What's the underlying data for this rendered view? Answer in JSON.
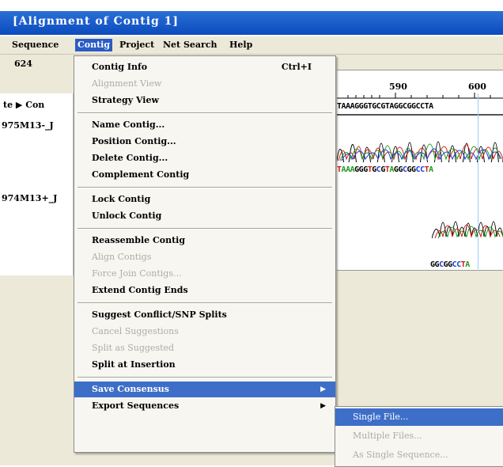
{
  "window": {
    "title": "[Alignment of Contig 1]"
  },
  "menubar": {
    "items": [
      {
        "label": "Sequence"
      },
      {
        "label": "Contig"
      },
      {
        "label": "Project"
      },
      {
        "label": "Net Search"
      },
      {
        "label": "Help"
      }
    ]
  },
  "editor": {
    "position": "624",
    "ticks": [
      "590",
      "600"
    ],
    "header_label": "te ▶ Con",
    "reads": [
      {
        "label": "975M13-_J"
      },
      {
        "label": "974M13+_J"
      }
    ],
    "sequences": {
      "consensus": "TAAAGGGTGCGTAGGCGGCCTA",
      "read1": "TAAAGGGTGCGTAGGCGGCCTA",
      "read2": "GGCGGCCTA"
    },
    "colors": {
      "a": "#1a9a1a",
      "c": "#1a3fd6",
      "g": "#000000",
      "t": "#d01a1a"
    }
  },
  "contig_menu": {
    "groups": [
      [
        {
          "label": "Contig Info",
          "shortcut": "Ctrl+I",
          "enabled": true
        },
        {
          "label": "Alignment View",
          "enabled": false
        },
        {
          "label": "Strategy View",
          "enabled": true
        }
      ],
      [
        {
          "label": "Name Contig...",
          "enabled": true
        },
        {
          "label": "Position Contig...",
          "enabled": true
        },
        {
          "label": "Delete Contig...",
          "enabled": true
        },
        {
          "label": "Complement Contig",
          "enabled": true
        }
      ],
      [
        {
          "label": "Lock Contig",
          "enabled": true
        },
        {
          "label": "Unlock Contig",
          "enabled": true
        }
      ],
      [
        {
          "label": "Reassemble Contig",
          "enabled": true
        },
        {
          "label": "Align Contigs",
          "enabled": false
        },
        {
          "label": "Force Join Contigs...",
          "enabled": false
        },
        {
          "label": "Extend Contig Ends",
          "enabled": true
        }
      ],
      [
        {
          "label": "Suggest Conflict/SNP Splits",
          "enabled": true
        },
        {
          "label": "Cancel Suggestions",
          "enabled": false
        },
        {
          "label": "Split as Suggested",
          "enabled": false
        },
        {
          "label": "Split at Insertion",
          "enabled": true
        }
      ],
      [
        {
          "label": "Save Consensus",
          "enabled": true,
          "submenu": true,
          "highlighted": true
        },
        {
          "label": "Export Sequences",
          "enabled": true,
          "submenu": true
        }
      ]
    ]
  },
  "save_consensus_submenu": {
    "items": [
      {
        "label": "Single File...",
        "enabled": true,
        "highlighted": true
      },
      {
        "label": "Multiple Files...",
        "enabled": false
      },
      {
        "label": "As Single Sequence...",
        "enabled": false
      }
    ]
  },
  "icons": {
    "submenu_arrow": "triangle-right-icon",
    "track_arrow": "triangle-right-icon"
  }
}
